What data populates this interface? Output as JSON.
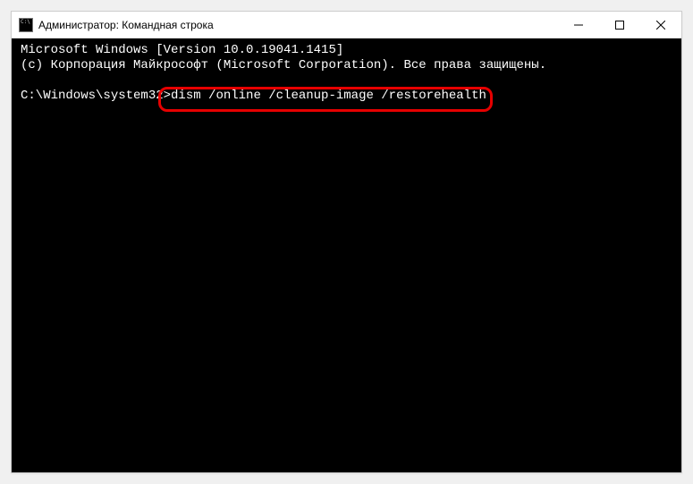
{
  "window": {
    "title": "Администратор: Командная строка"
  },
  "terminal": {
    "line1": "Microsoft Windows [Version 10.0.19041.1415]",
    "line2": "(c) Корпорация Майкрософт (Microsoft Corporation). Все права защищены.",
    "blank": "",
    "prompt": "C:\\Windows\\system32>",
    "command": "dism /online /cleanup-image /restorehealth"
  }
}
